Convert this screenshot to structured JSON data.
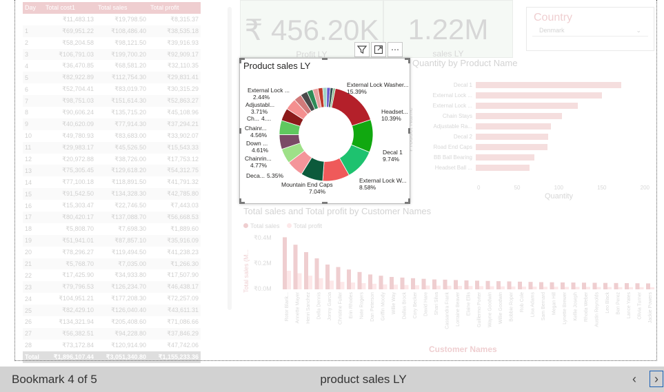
{
  "table": {
    "headers": [
      "Day",
      "Total cost1",
      "Total sales",
      "Total profit"
    ],
    "rows": [
      [
        "",
        "₹11,483.13",
        "₹19,798.50",
        "₹8,315.37"
      ],
      [
        "1",
        "₹69,951.22",
        "₹108,486.40",
        "₹38,535.18"
      ],
      [
        "2",
        "₹58,204.58",
        "₹98,121.50",
        "₹39,916.93"
      ],
      [
        "3",
        "₹106,791.03",
        "₹199,700.20",
        "₹92,909.17"
      ],
      [
        "4",
        "₹36,470.85",
        "₹68,581.20",
        "₹32,110.35"
      ],
      [
        "5",
        "₹82,922.89",
        "₹112,754.30",
        "₹29,831.41"
      ],
      [
        "6",
        "₹52,704.41",
        "₹83,019.70",
        "₹30,315.29"
      ],
      [
        "7",
        "₹98,751.03",
        "₹151,614.30",
        "₹52,863.27"
      ],
      [
        "8",
        "₹90,606.24",
        "₹135,715.20",
        "₹45,108.96"
      ],
      [
        "9",
        "₹40,620.09",
        "₹77,914.30",
        "₹37,294.21"
      ],
      [
        "10",
        "₹49,780.93",
        "₹83,683.00",
        "₹33,902.07"
      ],
      [
        "11",
        "₹29,983.17",
        "₹45,526.50",
        "₹15,543.33"
      ],
      [
        "12",
        "₹20,972.88",
        "₹38,726.00",
        "₹17,753.12"
      ],
      [
        "13",
        "₹75,305.45",
        "₹129,618.20",
        "₹54,312.75"
      ],
      [
        "14",
        "₹77,100.18",
        "₹118,891.50",
        "₹41,791.32"
      ],
      [
        "15",
        "₹91,542.50",
        "₹134,328.30",
        "₹42,785.80"
      ],
      [
        "16",
        "₹15,303.47",
        "₹22,746.50",
        "₹7,443.03"
      ],
      [
        "17",
        "₹80,420.17",
        "₹137,088.70",
        "₹56,668.53"
      ],
      [
        "18",
        "₹5,808.70",
        "₹7,698.30",
        "₹1,889.60"
      ],
      [
        "19",
        "₹51,941.01",
        "₹87,857.10",
        "₹35,916.09"
      ],
      [
        "20",
        "₹78,296.27",
        "₹119,494.50",
        "₹41,238.23"
      ],
      [
        "21",
        "₹5,768.70",
        "₹7,035.00",
        "₹1,266.30"
      ],
      [
        "22",
        "₹17,425.90",
        "₹34,933.80",
        "₹17,507.90"
      ],
      [
        "23",
        "₹79,796.53",
        "₹126,234.70",
        "₹46,438.17"
      ],
      [
        "24",
        "₹104,951.21",
        "₹177,208.30",
        "₹72,257.09"
      ],
      [
        "25",
        "₹82,429.10",
        "₹126,040.40",
        "₹43,611.31"
      ],
      [
        "26",
        "₹134,321.94",
        "₹205,408.60",
        "₹71,086.66"
      ],
      [
        "27",
        "₹56,382.51",
        "₹94,228.80",
        "₹37,846.29"
      ],
      [
        "28",
        "₹73,172.84",
        "₹120,914.90",
        "₹47,742.06"
      ]
    ],
    "total": [
      "Total",
      "₹1,896,107.44",
      "₹3,051,340.80",
      "₹1,155,233.36"
    ]
  },
  "kpis": [
    {
      "value": "₹ 456.20K",
      "label": "Profit LY"
    },
    {
      "value": "1.22M",
      "label": "sales LY"
    }
  ],
  "slicer": {
    "title": "Country",
    "value": "Denmark"
  },
  "quantity_chart": {
    "title": "Quantity by Product Name",
    "xlabel": "Quantity",
    "ylabel": "Product Name",
    "ticks": [
      "0",
      "50",
      "100",
      "150",
      "200"
    ],
    "items": [
      {
        "label": "Decal 1",
        "value": 172
      },
      {
        "label": "External Lock ...",
        "value": 149
      },
      {
        "label": "External Lock ...",
        "value": 121
      },
      {
        "label": "Chain Stays",
        "value": 102
      },
      {
        "label": "Adjustable Ra...",
        "value": 89
      },
      {
        "label": "Decal 2",
        "value": 86
      },
      {
        "label": "Road End Caps",
        "value": 85
      },
      {
        "label": "BB Ball Bearing",
        "value": 69
      },
      {
        "label": "Headset Ball ...",
        "value": 64
      }
    ]
  },
  "customer_chart": {
    "title": "Total sales and Total profit by Customer Names",
    "legend": [
      "Total sales",
      "Total profit"
    ],
    "ylabel": "Total sales (M...",
    "yticks": [
      "₹0.4M",
      "₹0.2M",
      "₹0.0M"
    ],
    "xlabel": "Customer Names",
    "customers": [
      "Rotor Blank...",
      "Annette Mayer",
      "Henri Sanchez",
      "Della Dennis",
      "Jonny Garcia",
      "Christine Fuller",
      "Erin Rhodes",
      "Nate Rogers",
      "Dan Peterson",
      "Griffin Moody",
      "Willie Way",
      "Dallas Brock",
      "Cory Becker",
      "David Hare",
      "Shari Silva",
      "Cassandra Frank",
      "Lorraine Beaver",
      "Elaine Ellis",
      "Guillermo Porter",
      "Wayne Goodwin",
      "Willie Goodwin",
      "Bobbie Roper",
      "Rob Cole",
      "Lisa Adams",
      "Sam Bernard",
      "Megan Hill",
      "Lynette Brewer",
      "Kellie Joseph",
      "Rhoda Weber",
      "Austin Reynolds",
      "Leo Black",
      "Ben Perez",
      "Lance Yates",
      "Olivia Turner",
      "Jackie Powers",
      "Tracey Beard"
    ],
    "sales": [
      0.42,
      0.36,
      0.3,
      0.25,
      0.2,
      0.18,
      0.16,
      0.14,
      0.12,
      0.11,
      0.1,
      0.095,
      0.09,
      0.085,
      0.08,
      0.078,
      0.075,
      0.072,
      0.07,
      0.068,
      0.066,
      0.064,
      0.062,
      0.06,
      0.058,
      0.057,
      0.056,
      0.055,
      0.054,
      0.053,
      0.052,
      0.051,
      0.05,
      0.049,
      0.048,
      0.047
    ],
    "profit": [
      0.15,
      0.13,
      0.11,
      0.09,
      0.07,
      0.06,
      0.055,
      0.05,
      0.045,
      0.04,
      0.038,
      0.035,
      0.033,
      0.031,
      0.03,
      0.029,
      0.028,
      0.027,
      0.026,
      0.025,
      0.024,
      0.023,
      0.022,
      0.022,
      0.021,
      0.021,
      0.02,
      0.02,
      0.02,
      0.019,
      0.019,
      0.018,
      0.018,
      0.018,
      0.017,
      0.017
    ]
  },
  "donut": {
    "title": "Product sales LY",
    "labels": [
      {
        "name": "External Lock Washer...",
        "pct": "15.39%"
      },
      {
        "name": "Headset...",
        "pct": "10.39%"
      },
      {
        "name": "Decal 1",
        "pct": "9.74%"
      },
      {
        "name": "External Lock W...",
        "pct": "8.58%"
      },
      {
        "name": "Mountain End Caps",
        "pct": "7.04%"
      },
      {
        "name": "Deca...",
        "pct": "5.35%"
      },
      {
        "name": "Chainrin...",
        "pct": "4.77%"
      },
      {
        "name": "Down ...",
        "pct": "4.61%"
      },
      {
        "name": "Chainr...",
        "pct": "4.56%"
      },
      {
        "name": "Ch...",
        "pct": "4...."
      },
      {
        "name": "Adjustabl...",
        "pct": "3.71%"
      },
      {
        "name": "External Lock ...",
        "pct": "2.44%"
      }
    ]
  },
  "chart_data": {
    "type": "pie",
    "title": "Product sales LY",
    "categories": [
      "External Lock Washer...",
      "Headset...",
      "Decal 1",
      "External Lock W...",
      "Mountain End Caps",
      "Deca...",
      "Chainrin...",
      "Down ...",
      "Chainr...",
      "Ch...",
      "Adjustabl...",
      "External Lock ...",
      "",
      "",
      "",
      "",
      "",
      "",
      "",
      ""
    ],
    "values": [
      15.39,
      10.39,
      9.74,
      8.58,
      7.04,
      5.35,
      4.77,
      4.61,
      4.56,
      4.0,
      3.71,
      2.44,
      2.2,
      1.9,
      1.7,
      1.5,
      1.3,
      1.1,
      0.9,
      0.7
    ],
    "colors": [
      "#b4202a",
      "#11a810",
      "#1ec26f",
      "#ef5a5a",
      "#0c5a3b",
      "#f4959a",
      "#9ee088",
      "#7a4a66",
      "#5fc85f",
      "#8b1a1a",
      "#f48f8f",
      "#d17a7a",
      "#4a4a4a",
      "#2e8b57",
      "#e8a0a0",
      "#c0392b",
      "#9fd3c7",
      "#6a5acd",
      "#2f4f4f",
      "#8fbc8f"
    ],
    "hole": 0.58
  },
  "toolbar": {
    "filter_icon": "filter-icon",
    "focus_icon": "focus-mode-icon",
    "more_label": "⋯"
  },
  "bottom_bar": {
    "count": "Bookmark 4 of 5",
    "name": "product sales LY",
    "prev": "‹",
    "next": "›"
  }
}
